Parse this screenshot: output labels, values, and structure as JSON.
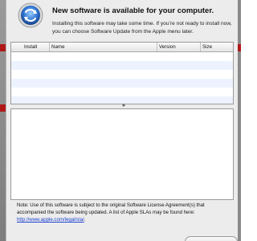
{
  "window": {
    "title": "New software is available for your computer.",
    "subtitle": "Installing this software may take some time. If you’re not ready to install now, you can choose Software Update from the Apple menu later.",
    "icon": "software-update-icon"
  },
  "table": {
    "columns": [
      "Install",
      "Name",
      "Version",
      "Size"
    ],
    "rows": []
  },
  "note": {
    "text": "Note: Use of this software is subject to the original Software License Agreement(s) that accompanied the software being updated. A list of Apple SLAs may be found here: ",
    "link": "http://www.apple.com/legal/sla/",
    "suffix": "."
  },
  "colors": {
    "accent_red": "#b01818",
    "row_stripe": "#edf3fe",
    "link": "#1a3fd1"
  }
}
